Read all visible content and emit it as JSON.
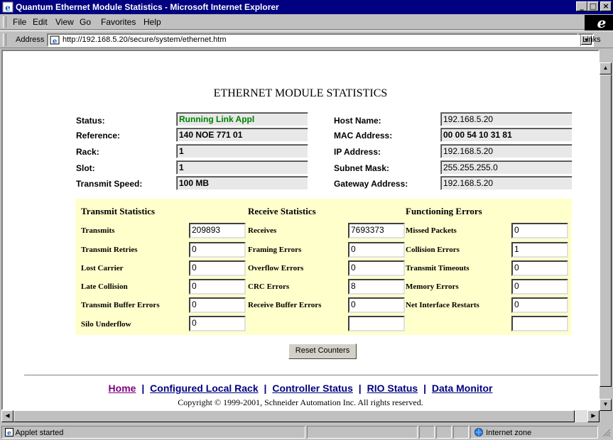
{
  "window": {
    "title": "Quantum Ethernet Module Statistics - Microsoft Internet Explorer",
    "controls": {
      "minimize": "_",
      "maximize": "□",
      "close": "×"
    }
  },
  "menu": {
    "items": [
      "File",
      "Edit",
      "View",
      "Go",
      "Favorites",
      "Help"
    ]
  },
  "address": {
    "label": "Address",
    "url": "http://192.168.5.20/secure/system/ethernet.htm",
    "links_label": "Links"
  },
  "page": {
    "title": "ETHERNET MODULE STATISTICS",
    "left_info": [
      {
        "label": "Status:",
        "value": "Running Link Appl",
        "color": "#008000"
      },
      {
        "label": "Reference:",
        "value": "140 NOE 771 01",
        "color": "#000000"
      },
      {
        "label": "Rack:",
        "value": "1",
        "color": "#000000"
      },
      {
        "label": "Slot:",
        "value": "1",
        "color": "#000000"
      },
      {
        "label": "Transmit Speed:",
        "value": "100 MB",
        "color": "#000000"
      }
    ],
    "right_info": [
      {
        "label": "Host Name:",
        "value": "192.168.5.20"
      },
      {
        "label": "MAC Address:",
        "value": "00 00 54 10 31 81"
      },
      {
        "label": "IP Address:",
        "value": "192.168.5.20"
      },
      {
        "label": "Subnet Mask:",
        "value": "255.255.255.0"
      },
      {
        "label": "Gateway Address:",
        "value": "192.168.5.20"
      }
    ],
    "stats": {
      "transmit": {
        "heading": "Transmit Statistics",
        "rows": [
          {
            "label": "Transmits",
            "value": "209893"
          },
          {
            "label": "Transmit Retries",
            "value": "0"
          },
          {
            "label": "Lost Carrier",
            "value": "0"
          },
          {
            "label": "Late Collision",
            "value": "0"
          },
          {
            "label": "Transmit Buffer Errors",
            "value": "0"
          },
          {
            "label": "Silo Underflow",
            "value": "0"
          }
        ]
      },
      "receive": {
        "heading": "Receive Statistics",
        "rows": [
          {
            "label": "Receives",
            "value": "7693373"
          },
          {
            "label": "Framing Errors",
            "value": "0"
          },
          {
            "label": "Overflow Errors",
            "value": "0"
          },
          {
            "label": "CRC Errors",
            "value": "8"
          },
          {
            "label": "Receive Buffer Errors",
            "value": "0"
          },
          {
            "label": "",
            "value": ""
          }
        ]
      },
      "functioning": {
        "heading": "Functioning Errors",
        "rows": [
          {
            "label": "Missed Packets",
            "value": "0"
          },
          {
            "label": "Collision Errors",
            "value": "1"
          },
          {
            "label": "Transmit Timeouts",
            "value": "0"
          },
          {
            "label": "Memory Errors",
            "value": "0"
          },
          {
            "label": "Net Interface Restarts",
            "value": "0"
          },
          {
            "label": "",
            "value": ""
          }
        ]
      }
    },
    "reset_button": "Reset Counters",
    "nav_links": [
      "Home",
      "Configured Local Rack",
      "Controller Status",
      "RIO Status",
      "Data Monitor"
    ],
    "nav_separator": "|",
    "link_color": "#000080",
    "home_color": "#800080",
    "copyright": "Copyright © 1999-2001, Schneider Automation Inc. All rights reserved."
  },
  "status_bar": {
    "text": "Applet started",
    "zone": "Internet zone"
  }
}
